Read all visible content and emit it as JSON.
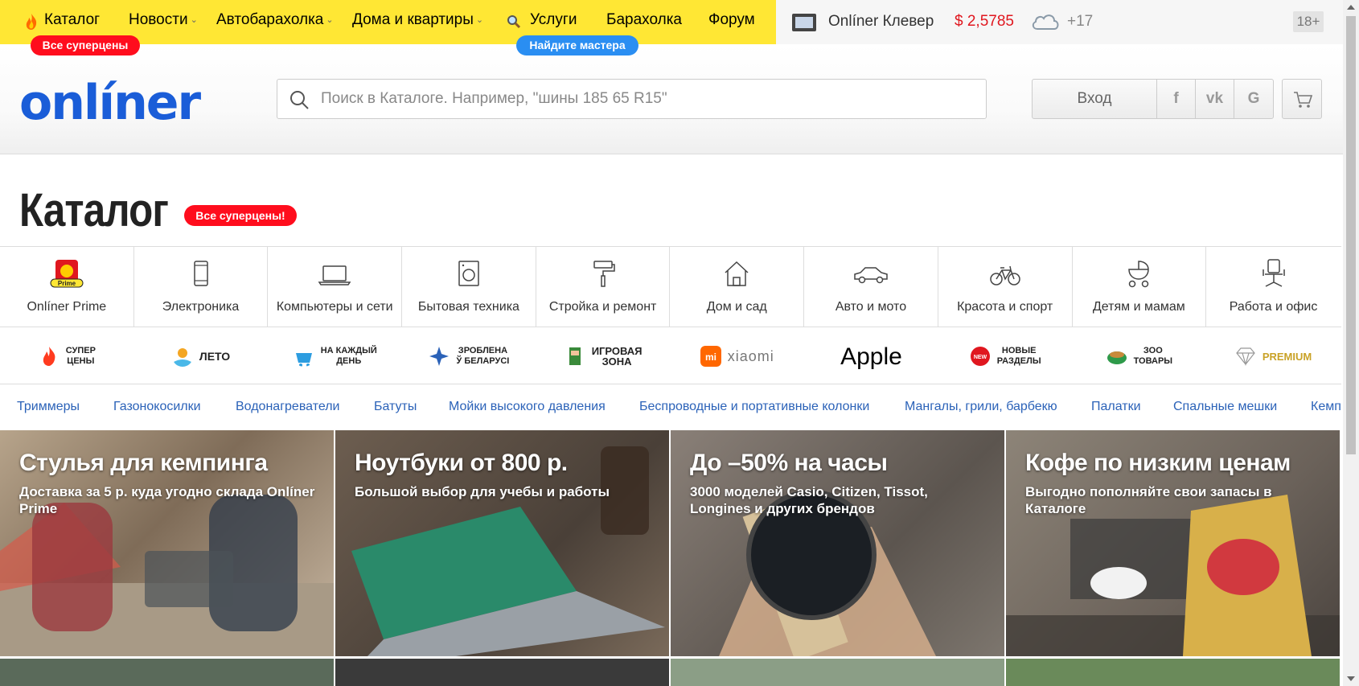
{
  "topnav": {
    "items": [
      {
        "label": "Каталог",
        "has_chevron": false
      },
      {
        "label": "Новости",
        "has_chevron": true
      },
      {
        "label": "Автобарахолка",
        "has_chevron": true
      },
      {
        "label": "Дома и квартиры",
        "has_chevron": true
      },
      {
        "label": "Услуги",
        "has_chevron": false
      },
      {
        "label": "Барахолка",
        "has_chevron": false
      },
      {
        "label": "Форум",
        "has_chevron": false
      }
    ],
    "pill_catalog": "Все суперцены",
    "pill_services": "Найдите мастера",
    "clever": "Onlíner Клевер",
    "rate": "$ 2,5785",
    "weather_temp": "+17",
    "age": "18+"
  },
  "header": {
    "logo": "onlíner",
    "search_placeholder": "Поиск в Каталоге. Например, \"шины 185 65 R15\"",
    "login": "Вход",
    "social": [
      "f",
      "vk",
      "G"
    ]
  },
  "catalog": {
    "title": "Каталог",
    "pill": "Все суперцены!",
    "categories": [
      {
        "label": "Onlíner Prime",
        "icon": "prime-icon"
      },
      {
        "label": "Электроника",
        "icon": "phone-icon"
      },
      {
        "label": "Компьютеры и сети",
        "icon": "laptop-icon"
      },
      {
        "label": "Бытовая техника",
        "icon": "washer-icon"
      },
      {
        "label": "Стройка и ремонт",
        "icon": "paint-roller-icon"
      },
      {
        "label": "Дом и сад",
        "icon": "house-icon"
      },
      {
        "label": "Авто и мото",
        "icon": "car-icon"
      },
      {
        "label": "Красота и спорт",
        "icon": "bicycle-icon"
      },
      {
        "label": "Детям и мамам",
        "icon": "stroller-icon"
      },
      {
        "label": "Работа и офис",
        "icon": "office-chair-icon"
      }
    ],
    "promos": [
      {
        "text": "СУПЕР\nЦЕНЫ",
        "icon": "flame-icon",
        "color": "#ff3b1f"
      },
      {
        "text": "ЛЕТО",
        "icon": "summer-icon",
        "color": "#f4a623"
      },
      {
        "text": "НА КАЖДЫЙ\nДЕНЬ",
        "icon": "basket-icon",
        "color": "#2d9de0"
      },
      {
        "text": "ЗРОБЛЕНА\nЎ БЕЛАРУСІ",
        "icon": "ornament-icon",
        "color": "#2b62b8"
      },
      {
        "text": "ИГРОВАЯ\nЗОНА",
        "icon": "gamer-icon",
        "color": "#3a8a3a"
      },
      {
        "text": "xiaomi",
        "icon": "mi-logo-icon",
        "color": "#ff6700"
      },
      {
        "text": "Apple",
        "icon": "",
        "color": "#000000"
      },
      {
        "text": "НОВЫЕ\nРАЗДЕЛЫ",
        "icon": "new-badge-icon",
        "color": "#e0171f"
      },
      {
        "text": "ЗОО\nТОВАРЫ",
        "icon": "pet-food-icon",
        "color": "#2e9a4a"
      },
      {
        "text": "PREMIUM",
        "icon": "diamond-icon",
        "color": "#c9a227"
      }
    ],
    "quick_links": [
      "Триммеры",
      "Газонокосилки",
      "Водонагреватели",
      "Батуты",
      "Мойки высокого давления",
      "Беспроводные и портативные колонки",
      "Мангалы, грили, барбекю",
      "Палатки",
      "Спальные мешки",
      "Кемп"
    ]
  },
  "banners": [
    {
      "title": "Стулья для кемпинга",
      "subtitle": "Доставка за 5 р. куда угодно склада Onlíner Prime",
      "bg": "#8c7a64"
    },
    {
      "title": "Ноутбуки от 800 р.",
      "subtitle": "Большой выбор для учебы и работы",
      "bg": "#5a5149"
    },
    {
      "title": "До –50% на часы",
      "subtitle": "3000 моделей Casio, Citizen, Tissot, Longines и других брендов",
      "bg": "#6f6860"
    },
    {
      "title": "Кофе по низким ценам",
      "subtitle": "Выгодно пополняйте свои запасы в Каталоге",
      "bg": "#7b6f62"
    }
  ]
}
